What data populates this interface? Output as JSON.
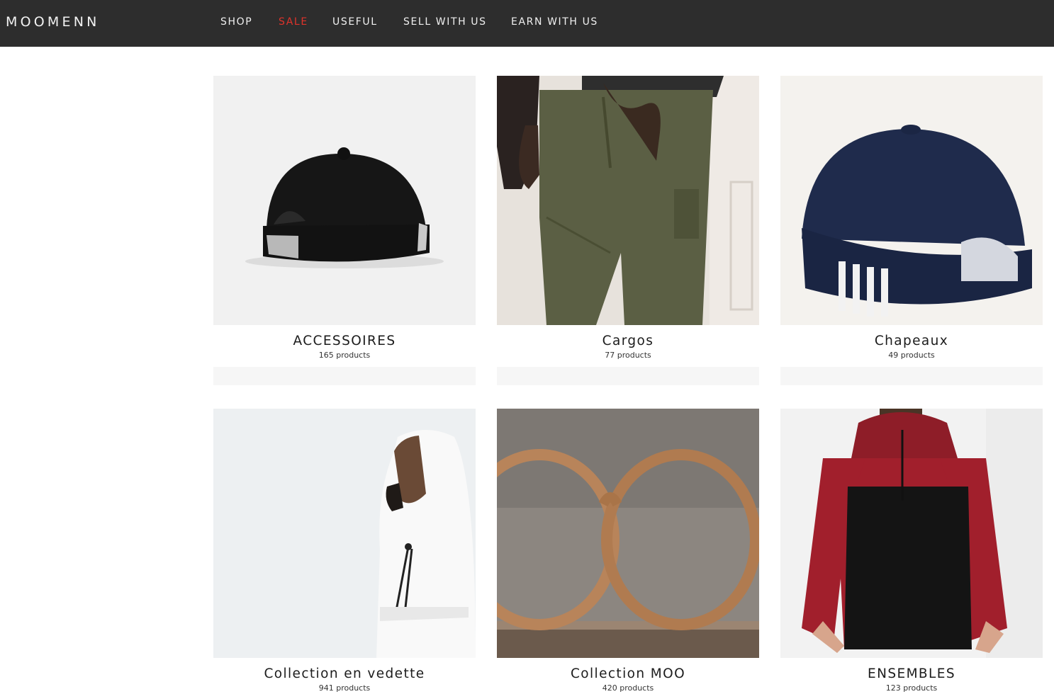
{
  "header": {
    "brand": "MOOMENN",
    "nav": [
      {
        "label": "SHOP"
      },
      {
        "label": "SALE"
      },
      {
        "label": "USEFUL"
      },
      {
        "label": "SELL WITH US"
      },
      {
        "label": "EARN WITH US"
      }
    ]
  },
  "collections": [
    {
      "title": "ACCESSOIRES",
      "count": "165 products",
      "image": "black-cap"
    },
    {
      "title": "Cargos",
      "count": "77 products",
      "image": "olive-cargo-pants"
    },
    {
      "title": "Chapeaux",
      "count": "49 products",
      "image": "navy-cap"
    },
    {
      "title": "Collection en vedette",
      "count": "941 products",
      "image": "white-hoodie"
    },
    {
      "title": "Collection MOO",
      "count": "420 products",
      "image": "wooden-glasses"
    },
    {
      "title": "ENSEMBLES",
      "count": "123 products",
      "image": "red-black-hoodie"
    }
  ],
  "colors": {
    "topbar": "#2d2d2d",
    "sale": "#e0332b",
    "tile_bar": "#f6f6f6"
  }
}
